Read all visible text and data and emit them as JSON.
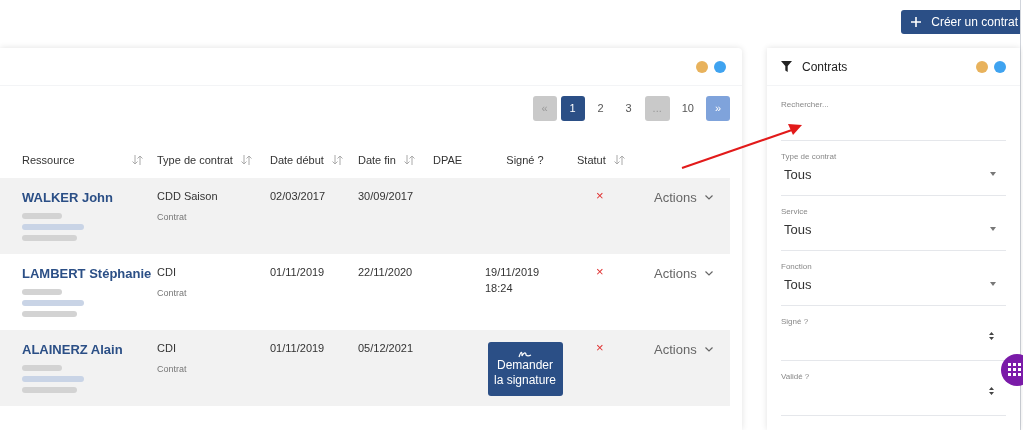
{
  "create_button": {
    "label": "Créer un contrat"
  },
  "main_panel": {
    "dots": [
      {
        "color": "#e8b25c"
      },
      {
        "color": "#3fa3f0"
      }
    ],
    "pagination": [
      {
        "label": "«",
        "kind": "prev",
        "selected": false
      },
      {
        "label": "1",
        "kind": "page",
        "selected": true
      },
      {
        "label": "2",
        "kind": "page",
        "selected": false
      },
      {
        "label": "3",
        "kind": "page",
        "selected": false
      },
      {
        "label": "...",
        "kind": "gap",
        "selected": false
      },
      {
        "label": "10",
        "kind": "page",
        "selected": false
      },
      {
        "label": "»",
        "kind": "next",
        "selected": false
      }
    ],
    "columns": [
      {
        "label": "Ressource",
        "sortable": true
      },
      {
        "label": "Type de contrat",
        "sortable": true
      },
      {
        "label": "Date début",
        "sortable": true
      },
      {
        "label": "Date fin",
        "sortable": true
      },
      {
        "label": "DPAE",
        "sortable": false
      },
      {
        "label": "Signé ?",
        "sortable": false
      },
      {
        "label": "Statut",
        "sortable": true
      }
    ],
    "rows": [
      {
        "name": "WALKER John",
        "type": "CDD Saison",
        "subtype": "Contrat",
        "start": "02/03/2017",
        "end": "30/09/2017",
        "signed": {
          "kind": "none"
        },
        "status": "×",
        "actions": "Actions"
      },
      {
        "name": "LAMBERT Stéphanie",
        "type": "CDI",
        "subtype": "Contrat",
        "start": "01/11/2019",
        "end": "22/11/2020",
        "signed": {
          "kind": "date",
          "text": "19/11/2019 18:24"
        },
        "status": "×",
        "actions": "Actions"
      },
      {
        "name": "ALAINERZ Alain",
        "type": "CDI",
        "subtype": "Contrat",
        "start": "01/11/2019",
        "end": "05/12/2021",
        "signed": {
          "kind": "button",
          "text": "Demander la signature"
        },
        "status": "×",
        "actions": "Actions"
      }
    ]
  },
  "filter_panel": {
    "title": "Contrats",
    "dots": [
      {
        "color": "#e8b25c"
      },
      {
        "color": "#3fa3f0"
      }
    ],
    "fields": [
      {
        "kind": "search",
        "placeholder": "Rechercher..."
      },
      {
        "kind": "select",
        "label": "Type de contrat",
        "value": "Tous"
      },
      {
        "kind": "select",
        "label": "Service",
        "value": "Tous"
      },
      {
        "kind": "select",
        "label": "Fonction",
        "value": "Tous"
      },
      {
        "kind": "spinner",
        "label": "Signé ?"
      },
      {
        "kind": "spinner",
        "label": "Validé ?"
      }
    ]
  }
}
